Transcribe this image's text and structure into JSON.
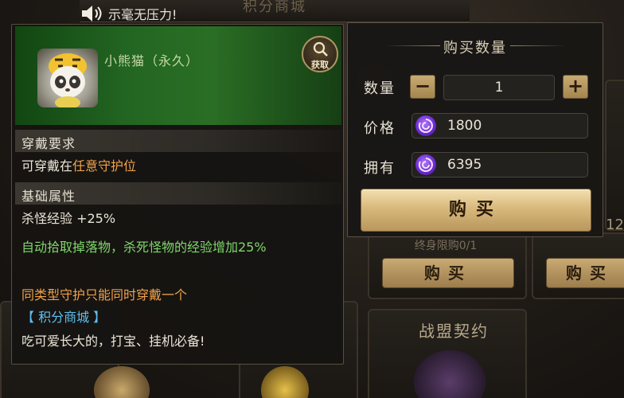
{
  "announcement": {
    "text": "示毫无压力!"
  },
  "background": {
    "shop_title": "积分商城",
    "purchase_limit": "终身限购0/1",
    "buy_label": "购买",
    "card_title": "战盟契约",
    "side_number": "12"
  },
  "item_detail": {
    "name": "小熊猫（永久）",
    "get_button_label": "获取",
    "sections": {
      "requirement_title": "穿戴要求",
      "requirement_prefix": "可穿戴在",
      "requirement_highlight": "任意守护位",
      "attribute_title": "基础属性",
      "attribute_line": "杀怪经验 +25%"
    },
    "effect_text": "自动拾取掉落物，杀死怪物的经验增加25%",
    "restriction_text": "同类型守护只能同时穿戴一个",
    "source_text": "【 积分商城 】",
    "flavor_text": "吃可爱长大的，打宝、挂机必备!"
  },
  "purchase_panel": {
    "title": "购买数量",
    "quantity_label": "数量",
    "quantity_value": "1",
    "decrement_glyph": "−",
    "increment_glyph": "+",
    "price_label": "价格",
    "price_value": "1800",
    "owned_label": "拥有",
    "owned_value": "6395",
    "buy_button_label": "购买",
    "currency_icon": "purple-swirl-gem-icon"
  },
  "colors": {
    "highlight_orange": "#f0a24b",
    "effect_green": "#7fd86a",
    "source_blue": "#5fc0ee",
    "button_gold": "#d8b97c"
  }
}
